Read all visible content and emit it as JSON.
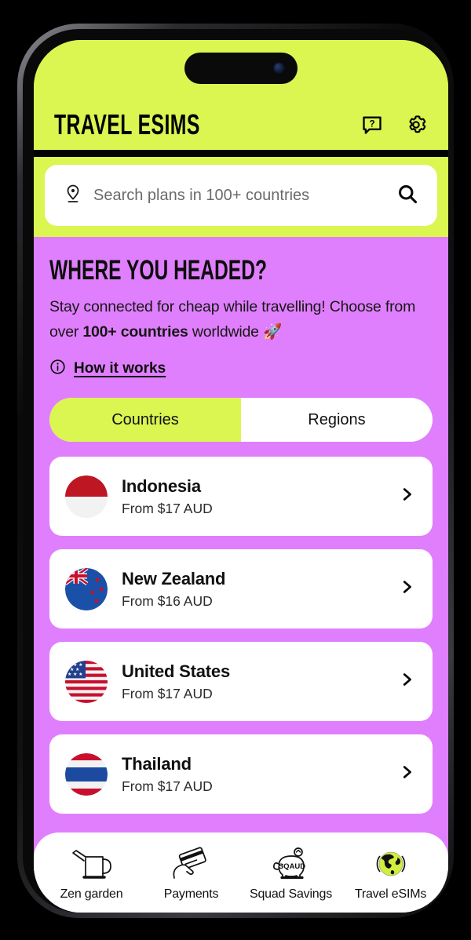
{
  "theme": {
    "lime": "#DBF551",
    "purple": "#E07FFD",
    "white": "#FFFFFF",
    "black": "#000000"
  },
  "header": {
    "title": "TRAVEL ESIMS",
    "help_icon": "help-speech-bubble-icon",
    "settings_icon": "gear-icon"
  },
  "search": {
    "placeholder": "Search plans in 100+ countries",
    "value": "",
    "pin_icon": "location-pin-icon",
    "search_icon": "magnifier-icon"
  },
  "hero": {
    "headline": "WHERE YOU HEADED?",
    "subtitle_part1": "Stay connected for cheap while travelling! Choose from over ",
    "subtitle_bold": "100+ countries",
    "subtitle_part2": " worldwide ",
    "subtitle_emoji": "🚀",
    "how_it_works": "How it works",
    "info_icon": "info-circle-icon"
  },
  "tabs": {
    "countries": "Countries",
    "regions": "Regions",
    "active": "Countries"
  },
  "countries": [
    {
      "name": "Indonesia",
      "price": "From $17 AUD",
      "flag": "flag-indonesia"
    },
    {
      "name": "New Zealand",
      "price": "From $16 AUD",
      "flag": "flag-new-zealand"
    },
    {
      "name": "United States",
      "price": "From $17 AUD",
      "flag": "flag-united-states"
    },
    {
      "name": "Thailand",
      "price": "From $17 AUD",
      "flag": "flag-thailand"
    }
  ],
  "bottom_nav": {
    "items": [
      {
        "label": "Zen garden",
        "icon": "watering-can-icon",
        "active": false
      },
      {
        "label": "Payments",
        "icon": "hand-holding-card-icon",
        "active": false
      },
      {
        "label": "Squad Savings",
        "icon": "piggy-bank-sqaud-icon",
        "active": false
      },
      {
        "label": "Travel eSIMs",
        "icon": "globe-icon",
        "active": true
      }
    ]
  }
}
